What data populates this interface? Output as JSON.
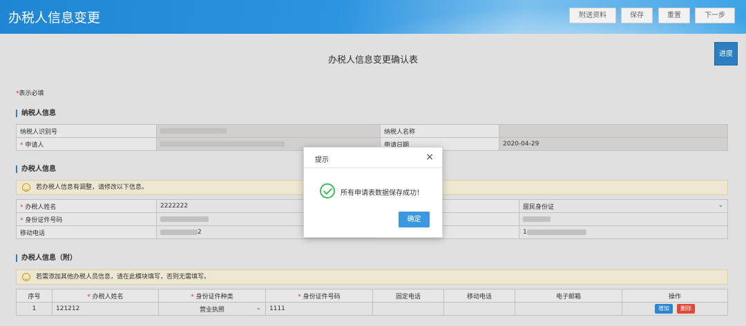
{
  "header": {
    "title": "办税人信息变更",
    "buttons": {
      "attach": "附送资料",
      "save": "保存",
      "reset": "重置",
      "next": "下一步"
    }
  },
  "form_title": "办税人信息变更确认表",
  "progress_label": "进度",
  "required_note": {
    "star": "*",
    "text": "表示必填"
  },
  "taxpayer": {
    "section": "纳税人信息",
    "id_label": "纳税人识别号",
    "name_label": "纳税人名称",
    "star": "*",
    "applicant_label": "申请人",
    "date_label": "申请日期",
    "date_value": "2020-04-29"
  },
  "handler": {
    "section": "办税人信息",
    "notice": "若办税人信息有调整，请修改以下信息。",
    "name_label": "办税人姓名",
    "name_value": "2222222",
    "id_type_value": "居民身份证",
    "id_number_label": "身份证件号码",
    "mobile_label": "移动电话",
    "mobile_tail": "2",
    "right_mobile_head": "1"
  },
  "extra": {
    "section": "办税人信息（附）",
    "notice": "若需添加其他办税人员信息，请在此模块填写，否则无需填写。",
    "headers": [
      "序号",
      "办税人姓名",
      "身份证件种类",
      "身份证件号码",
      "固定电话",
      "移动电话",
      "电子邮箱",
      "操作"
    ],
    "row": {
      "index": "1",
      "name": "121212",
      "id_type": "营业执照",
      "id_number": "1111"
    },
    "add_label": "增加",
    "delete_label": "删除"
  },
  "dialog": {
    "title": "提示",
    "close": "×",
    "message": "所有申请表数据保存成功！",
    "ok": "确定"
  },
  "colors": {
    "primary": "#2e83c8",
    "success": "#3dbd5a",
    "danger": "#e84b3a",
    "required": "#e23a2a"
  }
}
